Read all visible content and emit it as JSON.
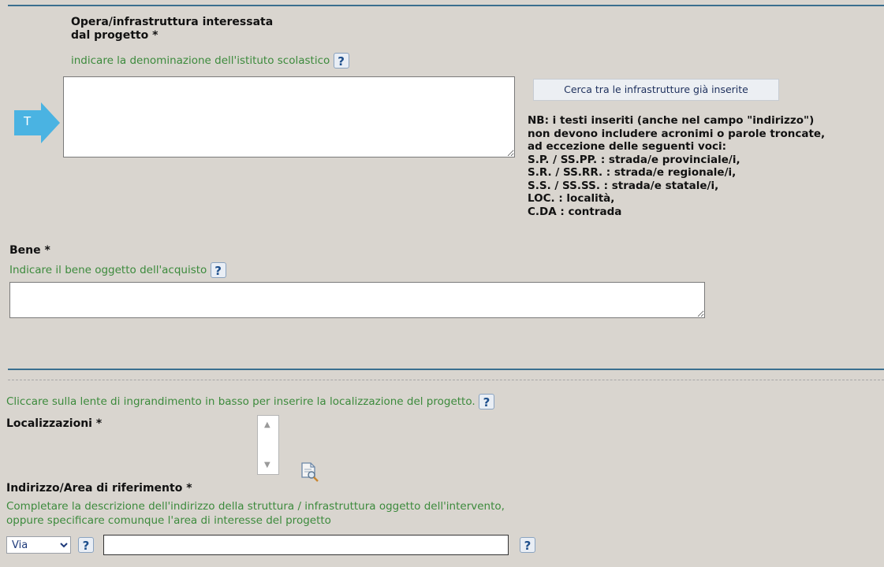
{
  "opera": {
    "title_line1": "Opera/infrastruttura interessata",
    "title_line2": "dal progetto *",
    "hint": "indicare la denominazione dell'istituto scolastico",
    "help": "?",
    "arrow_letter": "T",
    "search_button": "Cerca tra le infrastrutture già inserite",
    "nb_lines": [
      "NB: i testi inseriti (anche nel campo \"indirizzo\")",
      "non devono includere acronimi o parole troncate,",
      "ad eccezione delle seguenti voci:",
      "S.P. / SS.PP. : strada/e provinciale/i,",
      "S.R. / SS.RR. : strada/e regionale/i,",
      "S.S. / SS.SS. : strada/e statale/i,",
      "LOC. : località,",
      "C.DA : contrada"
    ]
  },
  "bene": {
    "title": "Bene *",
    "hint": "Indicare il bene oggetto dell'acquisto",
    "help": "?"
  },
  "localizzazione": {
    "instruction": "Cliccare sulla lente di ingrandimento in basso per inserire la localizzazione del progetto.",
    "help": "?",
    "title": "Localizzazioni *",
    "icon": "magnifier-document-icon"
  },
  "indirizzo": {
    "title": "Indirizzo/Area di riferimento *",
    "hint_line1": "Completare la descrizione dell'indirizzo della struttura / infrastruttura oggetto dell'intervento,",
    "hint_line2": "oppure specificare comunque l'area di interesse del progetto",
    "street_type_selected": "Via",
    "help": "?",
    "value": ""
  },
  "colors": {
    "accent_rule": "#3a6f8f",
    "hint_green": "#3c8a3c",
    "arrow_blue": "#4ab3e2"
  }
}
